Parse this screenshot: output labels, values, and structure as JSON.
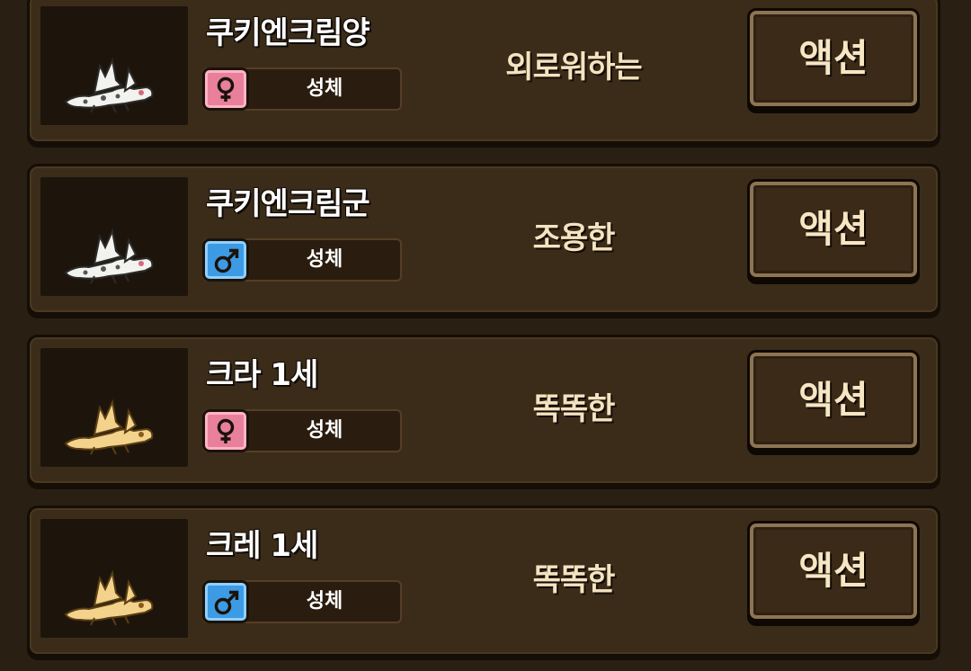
{
  "creatures": [
    {
      "name": "쿠키엔크림양",
      "gender": "female",
      "gender_icon": "female-symbol-icon",
      "stage": "성체",
      "trait": "외로워하는",
      "action_label": "액션",
      "color": "white"
    },
    {
      "name": "쿠키엔크림군",
      "gender": "male",
      "gender_icon": "male-symbol-icon",
      "stage": "성체",
      "trait": "조용한",
      "action_label": "액션",
      "color": "white"
    },
    {
      "name": "크라 1세",
      "gender": "female",
      "gender_icon": "female-symbol-icon",
      "stage": "성체",
      "trait": "똑똑한",
      "action_label": "액션",
      "color": "yellow"
    },
    {
      "name": "크레 1세",
      "gender": "male",
      "gender_icon": "male-symbol-icon",
      "stage": "성체",
      "trait": "똑똑한",
      "action_label": "액션",
      "color": "yellow"
    }
  ],
  "colors": {
    "background": "#2a1f13",
    "card": "#3b2c1a",
    "female": "#e8809c",
    "male": "#3d9ae4",
    "text_accent": "#f4e3c0"
  }
}
